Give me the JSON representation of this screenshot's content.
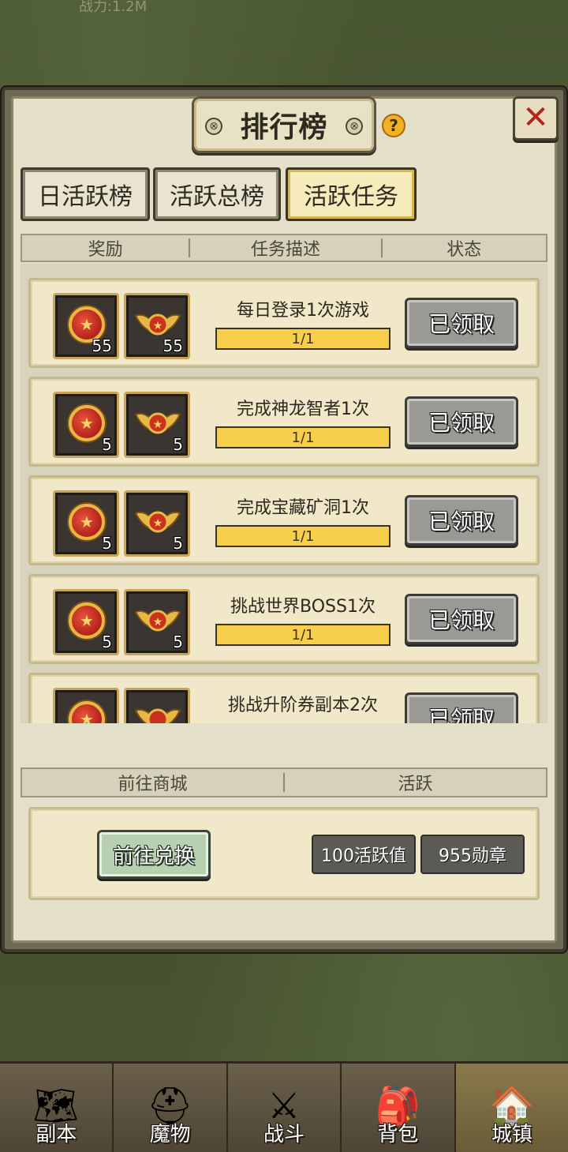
{
  "background": {
    "top_text": "战力:1.2M"
  },
  "header": {
    "title": "排行榜",
    "help_symbol": "?",
    "close_symbol": "✕"
  },
  "tabs": [
    {
      "label": "日活跃榜",
      "active": false
    },
    {
      "label": "活跃总榜",
      "active": false
    },
    {
      "label": "活跃任务",
      "active": true
    }
  ],
  "columns": {
    "reward": "奖励",
    "description": "任务描述",
    "status": "状态"
  },
  "tasks": [
    {
      "desc": "每日登录1次游戏",
      "progress": "1/1",
      "reward_a": "55",
      "reward_b": "55",
      "status": "已领取"
    },
    {
      "desc": "完成神龙智者1次",
      "progress": "1/1",
      "reward_a": "5",
      "reward_b": "5",
      "status": "已领取"
    },
    {
      "desc": "完成宝藏矿洞1次",
      "progress": "1/1",
      "reward_a": "5",
      "reward_b": "5",
      "status": "已领取"
    },
    {
      "desc": "挑战世界BOSS1次",
      "progress": "1/1",
      "reward_a": "5",
      "reward_b": "5",
      "status": "已领取"
    },
    {
      "desc": "挑战升阶券副本2次",
      "progress": "",
      "reward_a": "",
      "reward_b": "",
      "status": "已领取"
    }
  ],
  "shop": {
    "col_left": "前往商城",
    "col_right": "活跃",
    "exchange_label": "前往兑换",
    "active_value": "100活跃值",
    "medal_value": "955勋章"
  },
  "nav": [
    {
      "label": "副本",
      "icon": "map-icon",
      "active": false
    },
    {
      "label": "魔物",
      "icon": "monster-icon",
      "active": false
    },
    {
      "label": "战斗",
      "icon": "crossed-swords-icon",
      "active": false
    },
    {
      "label": "背包",
      "icon": "backpack-icon",
      "active": false
    },
    {
      "label": "城镇",
      "icon": "town-icon",
      "active": true
    }
  ],
  "colors": {
    "progress_fill": "#f8cf4c",
    "close_x": "#b3241c",
    "help": "#f3b224",
    "claimed_button": "#9a9994",
    "exchange_button": "#b7d1b0"
  }
}
